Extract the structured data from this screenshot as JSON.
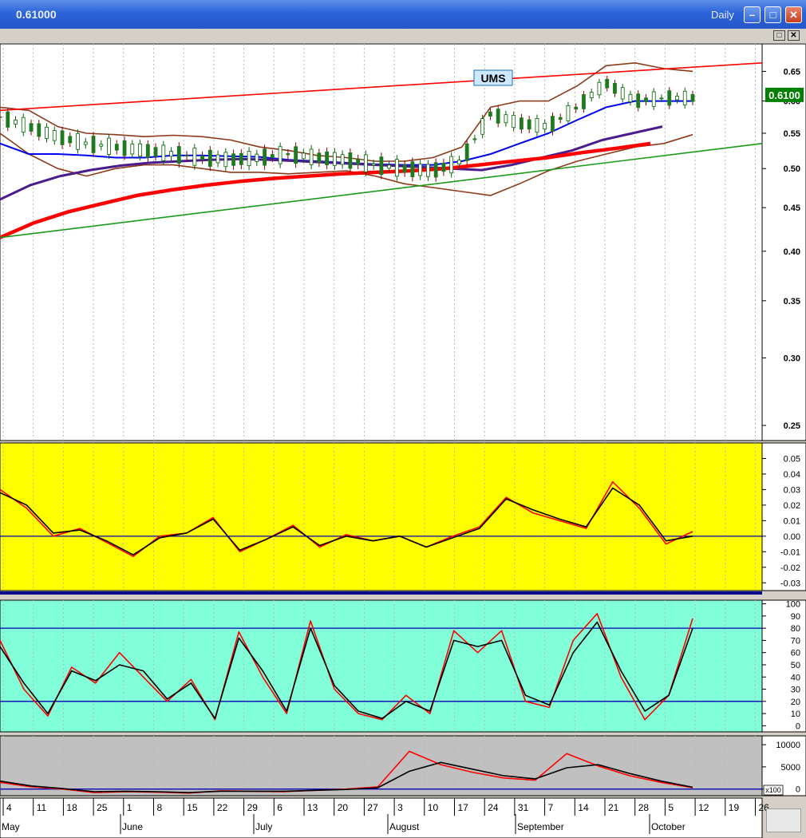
{
  "window": {
    "title": "0.61000",
    "period": "Daily",
    "buttons": [
      "minimize-button",
      "maximize-button",
      "close-button"
    ]
  },
  "colors": {
    "price_bg": "#ffffff",
    "osc1_bg": "#ffff00",
    "osc2_bg": "#80ffd8",
    "osc3_bg": "#c0c0c0",
    "signal_red": "#ff0000",
    "ma_blue": "#0000ee",
    "ma_purple": "#4b1c8c",
    "band_brown": "#8b3a1a",
    "channel_green": "#1a9a1a"
  },
  "chart_data": [
    {
      "type": "candlestick",
      "panel": "price",
      "title": "UMS",
      "y_scale": "log",
      "ylim": [
        0.24,
        0.7
      ],
      "y_ticks": [
        "0.65",
        "0.60",
        "0.55",
        "0.50",
        "0.45",
        "0.40",
        "0.35",
        "0.30",
        "0.25"
      ],
      "last_price_label": "0.6100",
      "x_tick_labels": [
        "4",
        "11",
        "18",
        "25",
        "1",
        "8",
        "15",
        "22",
        "29",
        "6",
        "13",
        "20",
        "27",
        "3",
        "10",
        "17",
        "24",
        "31",
        "7",
        "14",
        "21",
        "28",
        "5",
        "12",
        "19",
        "26"
      ],
      "month_labels": [
        "May",
        "June",
        "July",
        "August",
        "September",
        "October"
      ],
      "series": [
        {
          "name": "close",
          "values": [
            0.575,
            0.56,
            0.545,
            0.535,
            0.53,
            0.525,
            0.52,
            0.515,
            0.512,
            0.515,
            0.52,
            0.515,
            0.512,
            0.505,
            0.5,
            0.497,
            0.51,
            0.58,
            0.565,
            0.56,
            0.59,
            0.63,
            0.6,
            0.605,
            0.605
          ]
        },
        {
          "name": "bb_upper",
          "values": [
            0.59,
            0.585,
            0.56,
            0.55,
            0.548,
            0.545,
            0.547,
            0.545,
            0.54,
            0.53,
            0.525,
            0.518,
            0.515,
            0.51,
            0.51,
            0.515,
            0.53,
            0.59,
            0.6,
            0.6,
            0.625,
            0.66,
            0.665,
            0.655,
            0.65
          ]
        },
        {
          "name": "bb_lower",
          "values": [
            0.55,
            0.52,
            0.5,
            0.49,
            0.5,
            0.505,
            0.505,
            0.5,
            0.495,
            0.495,
            0.493,
            0.495,
            0.497,
            0.49,
            0.48,
            0.475,
            0.47,
            0.465,
            0.48,
            0.497,
            0.51,
            0.52,
            0.53,
            0.535,
            0.548
          ]
        },
        {
          "name": "ma_blue",
          "values": [
            0.535,
            0.52,
            0.52,
            0.518,
            0.515,
            0.515,
            0.518,
            0.518,
            0.517,
            0.516,
            0.512,
            0.51,
            0.508,
            0.506,
            0.505,
            0.505,
            0.51,
            0.52,
            0.535,
            0.55,
            0.57,
            0.59,
            0.6,
            0.6,
            0.6
          ]
        },
        {
          "name": "ma_purple",
          "values": [
            0.46,
            0.478,
            0.49,
            0.498,
            0.504,
            0.508,
            0.51,
            0.512,
            0.513,
            0.512,
            0.51,
            0.508,
            0.506,
            0.504,
            0.502,
            0.5,
            0.498,
            0.505,
            0.515,
            0.525,
            0.54,
            0.55,
            0.56
          ]
        },
        {
          "name": "ma_red",
          "values": [
            0.415,
            0.432,
            0.445,
            0.455,
            0.465,
            0.472,
            0.478,
            0.483,
            0.487,
            0.49,
            0.493,
            0.495,
            0.497,
            0.5,
            0.505,
            0.51,
            0.515,
            0.522,
            0.528,
            0.535
          ]
        },
        {
          "name": "channel_upper",
          "x": [
            0,
            25
          ],
          "values": [
            0.585,
            0.665
          ]
        },
        {
          "name": "channel_lower",
          "x": [
            0,
            25
          ],
          "values": [
            0.415,
            0.535
          ]
        }
      ]
    },
    {
      "type": "line",
      "panel": "oscillator",
      "ylim": [
        -0.035,
        0.06
      ],
      "y_ticks": [
        "0.05",
        "0.04",
        "0.03",
        "0.02",
        "0.01",
        "0.00",
        "-0.01",
        "-0.02",
        "-0.03"
      ],
      "reference_lines": [
        0
      ],
      "series": [
        {
          "name": "osc",
          "values": [
            0.03,
            0.018,
            0.0,
            0.005,
            -0.004,
            -0.013,
            0.0,
            0.002,
            0.012,
            -0.01,
            -0.002,
            0.007,
            -0.007,
            0.001,
            -0.003,
            0.0,
            -0.007,
            0.0,
            0.006,
            0.025,
            0.015,
            0.01,
            0.005,
            0.035,
            0.018,
            -0.005,
            0.003
          ]
        },
        {
          "name": "signal",
          "values": [
            0.028,
            0.02,
            0.002,
            0.004,
            -0.003,
            -0.012,
            -0.001,
            0.002,
            0.011,
            -0.009,
            -0.002,
            0.006,
            -0.006,
            0.0,
            -0.003,
            0.0,
            -0.007,
            -0.001,
            0.005,
            0.024,
            0.017,
            0.011,
            0.006,
            0.031,
            0.02,
            -0.003,
            0.0
          ]
        }
      ]
    },
    {
      "type": "line",
      "panel": "stochastic",
      "ylim": [
        -5,
        103
      ],
      "y_ticks": [
        "100",
        "90",
        "80",
        "70",
        "60",
        "50",
        "40",
        "30",
        "20",
        "10",
        "0"
      ],
      "reference_lines": [
        80,
        20
      ],
      "series": [
        {
          "name": "%K",
          "values": [
            70,
            30,
            8,
            48,
            35,
            60,
            40,
            20,
            38,
            5,
            77,
            40,
            10,
            86,
            30,
            10,
            5,
            25,
            10,
            78,
            60,
            78,
            20,
            15,
            70,
            92,
            40,
            5,
            25,
            88
          ]
        },
        {
          "name": "%D",
          "values": [
            65,
            35,
            10,
            45,
            37,
            50,
            45,
            22,
            35,
            6,
            72,
            45,
            12,
            80,
            33,
            12,
            6,
            20,
            12,
            70,
            65,
            70,
            25,
            17,
            60,
            85,
            45,
            12,
            25,
            80
          ]
        }
      ]
    },
    {
      "type": "line",
      "panel": "volume-oscillator",
      "ylim": [
        -1500,
        12000
      ],
      "y_ticks": [
        "10000",
        "5000",
        "0"
      ],
      "scale_label": "x100",
      "reference_lines": [
        0
      ],
      "series": [
        {
          "name": "osc",
          "values": [
            1500,
            500,
            0,
            -800,
            -600,
            -700,
            -900,
            -400,
            -500,
            -600,
            -300,
            0,
            500,
            8500,
            5500,
            3800,
            2500,
            2000,
            8000,
            5200,
            3000,
            1500,
            300
          ]
        },
        {
          "name": "signal",
          "values": [
            1800,
            700,
            100,
            -600,
            -500,
            -600,
            -800,
            -500,
            -500,
            -500,
            -300,
            -100,
            300,
            4000,
            6000,
            4500,
            3000,
            2300,
            4800,
            5500,
            3500,
            1800,
            400
          ]
        }
      ]
    }
  ]
}
